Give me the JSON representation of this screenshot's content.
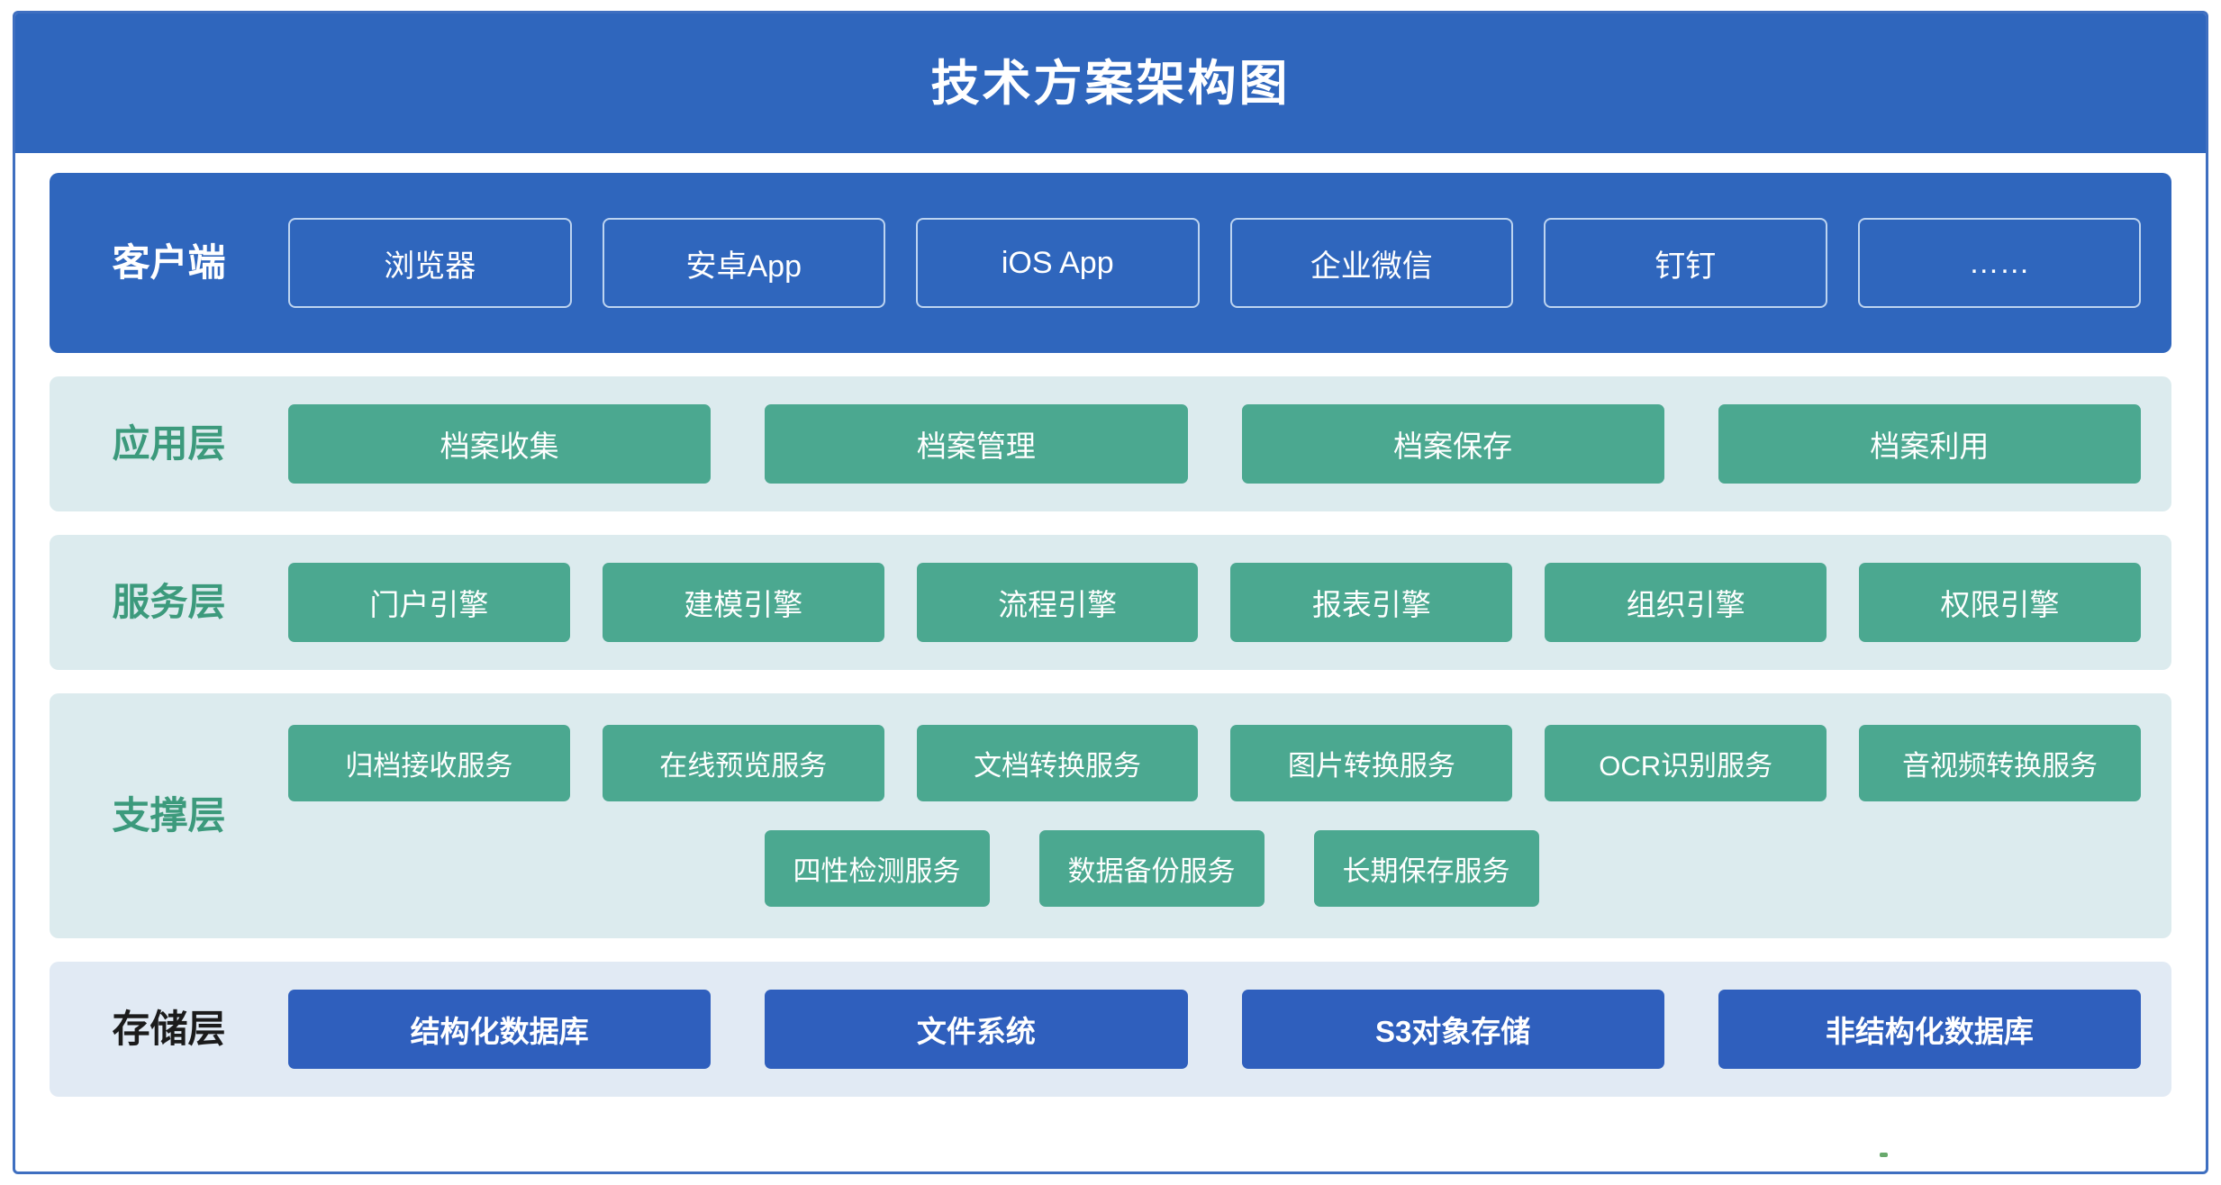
{
  "header": {
    "title": "技术方案架构图",
    "bg_color": "#2f66bd",
    "text_color": "#ffffff"
  },
  "theme": {
    "frame_border_color": "#3f6fc0",
    "blue": "#2f66bd",
    "storage_blue": "#2f5fbd",
    "green": "#4ba890",
    "green_label": "#3c9a7c",
    "band_bg_teal": "#dcebee",
    "band_bg_blue": "#e1eaf4",
    "client_box_border": "#bdd4f0"
  },
  "layers": {
    "client": {
      "label": "客户端",
      "items": [
        {
          "label": "浏览器"
        },
        {
          "label": "安卓App"
        },
        {
          "label": "iOS App"
        },
        {
          "label": "企业微信"
        },
        {
          "label": "钉钉"
        },
        {
          "label": "……"
        }
      ]
    },
    "application": {
      "label": "应用层",
      "items": [
        {
          "label": "档案收集"
        },
        {
          "label": "档案管理"
        },
        {
          "label": "档案保存"
        },
        {
          "label": "档案利用"
        }
      ]
    },
    "service": {
      "label": "服务层",
      "items": [
        {
          "label": "门户引擎"
        },
        {
          "label": "建模引擎"
        },
        {
          "label": "流程引擎"
        },
        {
          "label": "报表引擎"
        },
        {
          "label": "组织引擎"
        },
        {
          "label": "权限引擎"
        }
      ]
    },
    "support": {
      "label": "支撑层",
      "row1": [
        {
          "label": "归档接收服务"
        },
        {
          "label": "在线预览服务"
        },
        {
          "label": "文档转换服务"
        },
        {
          "label": "图片转换服务"
        },
        {
          "label": "OCR识别服务"
        },
        {
          "label": "音视频转换服务"
        }
      ],
      "row2": [
        {
          "label": "四性检测服务"
        },
        {
          "label": "数据备份服务"
        },
        {
          "label": "长期保存服务"
        }
      ]
    },
    "storage": {
      "label": "存储层",
      "items": [
        {
          "label": "结构化数据库"
        },
        {
          "label": "文件系统"
        },
        {
          "label": "S3对象存储"
        },
        {
          "label": "非结构化数据库"
        }
      ]
    }
  }
}
